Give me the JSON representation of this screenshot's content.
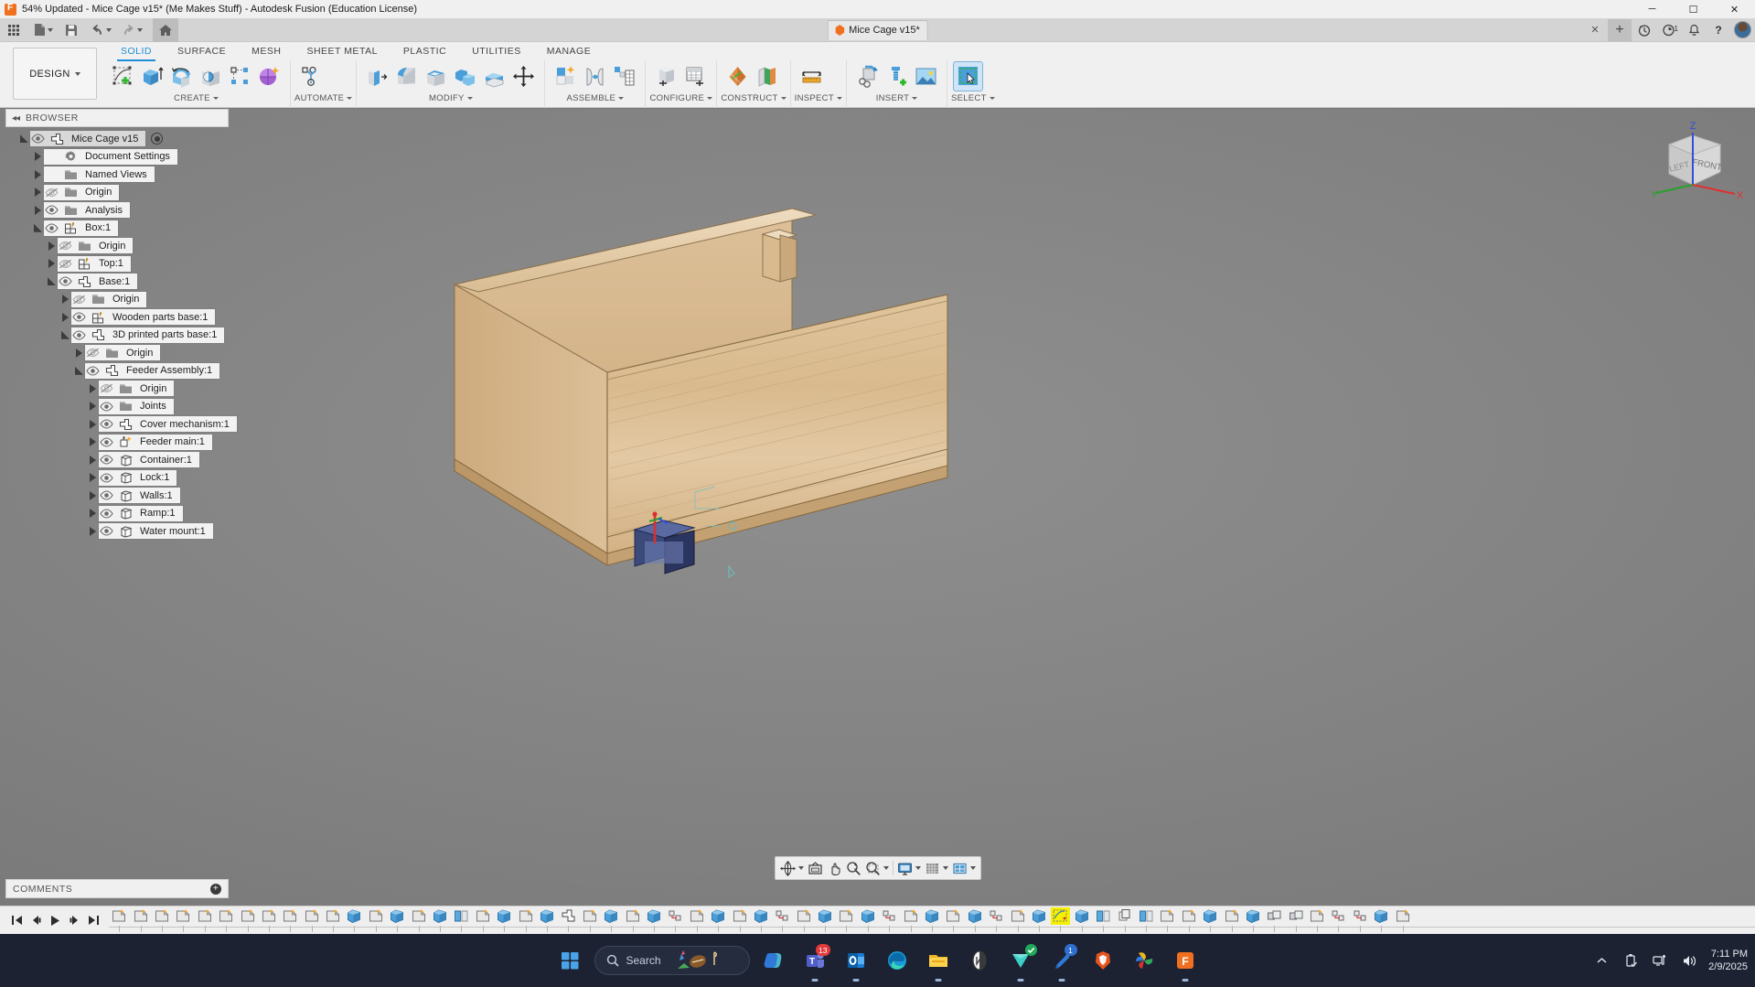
{
  "window": {
    "title": "54% Updated - Mice Cage v15* (Me Makes Stuff) - Autodesk Fusion (Education License)",
    "minimize": "─",
    "maximize": "☐",
    "close": "✕"
  },
  "quick_access": {
    "grid_menu": "grid-menu-icon",
    "new_file": "new-file-icon",
    "save": "save-icon",
    "undo": "undo-icon",
    "redo": "redo-icon",
    "home": "home-icon"
  },
  "document_tab": {
    "label": "Mice Cage v15*",
    "close": "✕"
  },
  "top_right": {
    "add_tab": "+",
    "history": "history-icon",
    "job_status": "job-status-icon",
    "job_count": "1",
    "notifications": "bell-icon",
    "help": "?",
    "account": "avatar"
  },
  "ribbon": {
    "workspace": "DESIGN",
    "tabs": [
      {
        "label": "SOLID",
        "selected": true
      },
      {
        "label": "SURFACE",
        "selected": false
      },
      {
        "label": "MESH",
        "selected": false
      },
      {
        "label": "SHEET METAL",
        "selected": false
      },
      {
        "label": "PLASTIC",
        "selected": false
      },
      {
        "label": "UTILITIES",
        "selected": false
      },
      {
        "label": "MANAGE",
        "selected": false
      }
    ],
    "panels": [
      {
        "label": "CREATE",
        "dropdown": true,
        "icons": [
          "create-sketch-icon",
          "extrude-icon",
          "revolve-icon",
          "hole-icon",
          "rectangular-pattern-icon",
          "form-icon"
        ]
      },
      {
        "label": "AUTOMATE",
        "dropdown": true,
        "icons": [
          "automate-icon"
        ]
      },
      {
        "label": "MODIFY",
        "dropdown": true,
        "icons": [
          "press-pull-icon",
          "fillet-icon",
          "shell-icon",
          "combine-icon",
          "offset-face-icon",
          "move-copy-icon"
        ]
      },
      {
        "label": "ASSEMBLE",
        "dropdown": true,
        "icons": [
          "new-component-icon",
          "joint-icon",
          "motion-study-icon"
        ]
      },
      {
        "label": "CONFIGURE",
        "dropdown": true,
        "icons": [
          "create-configuration-icon",
          "configuration-table-icon"
        ]
      },
      {
        "label": "CONSTRUCT",
        "dropdown": true,
        "icons": [
          "offset-plane-icon",
          "plane-at-angle-icon"
        ]
      },
      {
        "label": "INSPECT",
        "dropdown": true,
        "icons": [
          "measure-icon"
        ]
      },
      {
        "label": "INSERT",
        "dropdown": true,
        "icons": [
          "derive-icon",
          "insert-mcmaster-icon",
          "canvas-icon"
        ]
      },
      {
        "label": "SELECT",
        "dropdown": true,
        "icons": [
          "select-window-icon"
        ]
      }
    ]
  },
  "browser": {
    "title": "BROWSER",
    "collapse_icon": "collapse-left-icon",
    "tree": [
      {
        "label": "Mice Cage v15",
        "indent": 0,
        "arrow": "open",
        "eye": "visible",
        "icon": "component-icon",
        "selected": true,
        "radio": true
      },
      {
        "label": "Document Settings",
        "indent": 1,
        "arrow": "closed",
        "eye": "none",
        "icon": "gear-icon"
      },
      {
        "label": "Named Views",
        "indent": 1,
        "arrow": "closed",
        "eye": "none",
        "icon": "folder-icon"
      },
      {
        "label": "Origin",
        "indent": 1,
        "arrow": "closed",
        "eye": "hidden",
        "icon": "folder-icon"
      },
      {
        "label": "Analysis",
        "indent": 1,
        "arrow": "closed",
        "eye": "visible",
        "icon": "folder-icon"
      },
      {
        "label": "Box:1",
        "indent": 1,
        "arrow": "open",
        "eye": "visible",
        "icon": "component-joint-icon"
      },
      {
        "label": "Origin",
        "indent": 2,
        "arrow": "closed",
        "eye": "hidden",
        "icon": "folder-icon"
      },
      {
        "label": "Top:1",
        "indent": 2,
        "arrow": "closed",
        "eye": "hidden",
        "icon": "component-joint-icon"
      },
      {
        "label": "Base:1",
        "indent": 2,
        "arrow": "open",
        "eye": "visible",
        "icon": "component-icon"
      },
      {
        "label": "Origin",
        "indent": 3,
        "arrow": "closed",
        "eye": "hidden",
        "icon": "folder-icon"
      },
      {
        "label": "Wooden parts base:1",
        "indent": 3,
        "arrow": "closed",
        "eye": "visible",
        "icon": "component-joint-icon"
      },
      {
        "label": "3D printed parts base:1",
        "indent": 3,
        "arrow": "open",
        "eye": "visible",
        "icon": "component-icon"
      },
      {
        "label": "Origin",
        "indent": 4,
        "arrow": "closed",
        "eye": "hidden",
        "icon": "folder-icon"
      },
      {
        "label": "Feeder Assembly:1",
        "indent": 4,
        "arrow": "open",
        "eye": "visible",
        "icon": "component-icon"
      },
      {
        "label": "Origin",
        "indent": 5,
        "arrow": "closed",
        "eye": "hidden",
        "icon": "folder-icon"
      },
      {
        "label": "Joints",
        "indent": 5,
        "arrow": "closed",
        "eye": "visible",
        "icon": "folder-icon"
      },
      {
        "label": "Cover mechanism:1",
        "indent": 5,
        "arrow": "closed",
        "eye": "visible",
        "icon": "component-icon"
      },
      {
        "label": "Feeder main:1",
        "indent": 5,
        "arrow": "closed",
        "eye": "visible",
        "icon": "component-new-icon"
      },
      {
        "label": "Container:1",
        "indent": 5,
        "arrow": "closed",
        "eye": "visible",
        "icon": "body-icon"
      },
      {
        "label": "Lock:1",
        "indent": 5,
        "arrow": "closed",
        "eye": "visible",
        "icon": "body-icon"
      },
      {
        "label": "Walls:1",
        "indent": 5,
        "arrow": "closed",
        "eye": "visible",
        "icon": "body-icon"
      },
      {
        "label": "Ramp:1",
        "indent": 5,
        "arrow": "closed",
        "eye": "visible",
        "icon": "body-icon"
      },
      {
        "label": "Water mount:1",
        "indent": 5,
        "arrow": "closed",
        "eye": "visible",
        "icon": "body-icon"
      }
    ]
  },
  "comments": {
    "title": "COMMENTS",
    "add": "+"
  },
  "viewcube": {
    "face_left": "LEFT",
    "face_front": "FRONT",
    "axis_x": "X",
    "axis_y": "Y",
    "axis_z": "Z",
    "color_x": "#e03030",
    "color_y": "#2aa02a",
    "color_z": "#3050d8"
  },
  "navbar": {
    "items": [
      {
        "name": "orbit-icon",
        "dropdown": true
      },
      {
        "name": "look-at-icon",
        "dropdown": false
      },
      {
        "name": "pan-icon",
        "dropdown": false
      },
      {
        "name": "zoom-icon",
        "dropdown": false
      },
      {
        "name": "zoom-window-icon",
        "dropdown": true
      },
      {
        "name": "display-settings-icon",
        "dropdown": true
      },
      {
        "name": "grid-snap-icon",
        "dropdown": true
      },
      {
        "name": "viewports-icon",
        "dropdown": true
      }
    ]
  },
  "timeline": {
    "controls": [
      "go-to-beginning-icon",
      "step-back-icon",
      "play-icon",
      "step-forward-icon",
      "go-to-end-icon"
    ],
    "node_count": 61,
    "highlighted_index": 44,
    "nodes": [
      "sketch",
      "sketch",
      "sketch",
      "sketch",
      "sketch",
      "sketch",
      "sketch",
      "sketch",
      "sketch",
      "sketch",
      "sketch",
      "extrude",
      "sketch",
      "extrude",
      "sketch",
      "extrude",
      "mirror",
      "sketch",
      "extrude",
      "sketch",
      "extrude",
      "component",
      "sketch",
      "extrude",
      "sketch",
      "extrude",
      "joint",
      "sketch",
      "extrude",
      "sketch",
      "extrude",
      "joint",
      "sketch",
      "extrude",
      "sketch",
      "extrude",
      "joint",
      "sketch",
      "extrude",
      "sketch",
      "extrude",
      "joint",
      "sketch",
      "extrude",
      "sketch-hl",
      "extrude",
      "mirror",
      "copy",
      "mirror",
      "sketch",
      "sketch",
      "extrude",
      "sketch",
      "extrude",
      "combine",
      "combine",
      "sketch",
      "joint",
      "joint",
      "extrude",
      "sketch"
    ]
  },
  "taskbar": {
    "start": "windows-start-icon",
    "search_placeholder": "Search",
    "items": [
      {
        "name": "copilot-icon",
        "badge": ""
      },
      {
        "name": "teams-icon",
        "badge": "13"
      },
      {
        "name": "outlook-icon",
        "badge": ""
      },
      {
        "name": "edge-icon",
        "badge": ""
      },
      {
        "name": "file-explorer-icon",
        "badge": ""
      },
      {
        "name": "onenote-icon",
        "badge": ""
      },
      {
        "name": "todo-icon",
        "badge": "check"
      },
      {
        "name": "tasks-icon",
        "badge": "1"
      },
      {
        "name": "brave-icon",
        "badge": ""
      },
      {
        "name": "pinwheel-icon",
        "badge": ""
      },
      {
        "name": "fusion-icon",
        "badge": ""
      }
    ],
    "tray": {
      "chevron": "show-hidden-icons-icon",
      "usb": "usb-safely-remove-icon",
      "network": "network-icon",
      "volume": "volume-icon",
      "time": "7:11 PM",
      "date": "2/9/2025"
    }
  }
}
